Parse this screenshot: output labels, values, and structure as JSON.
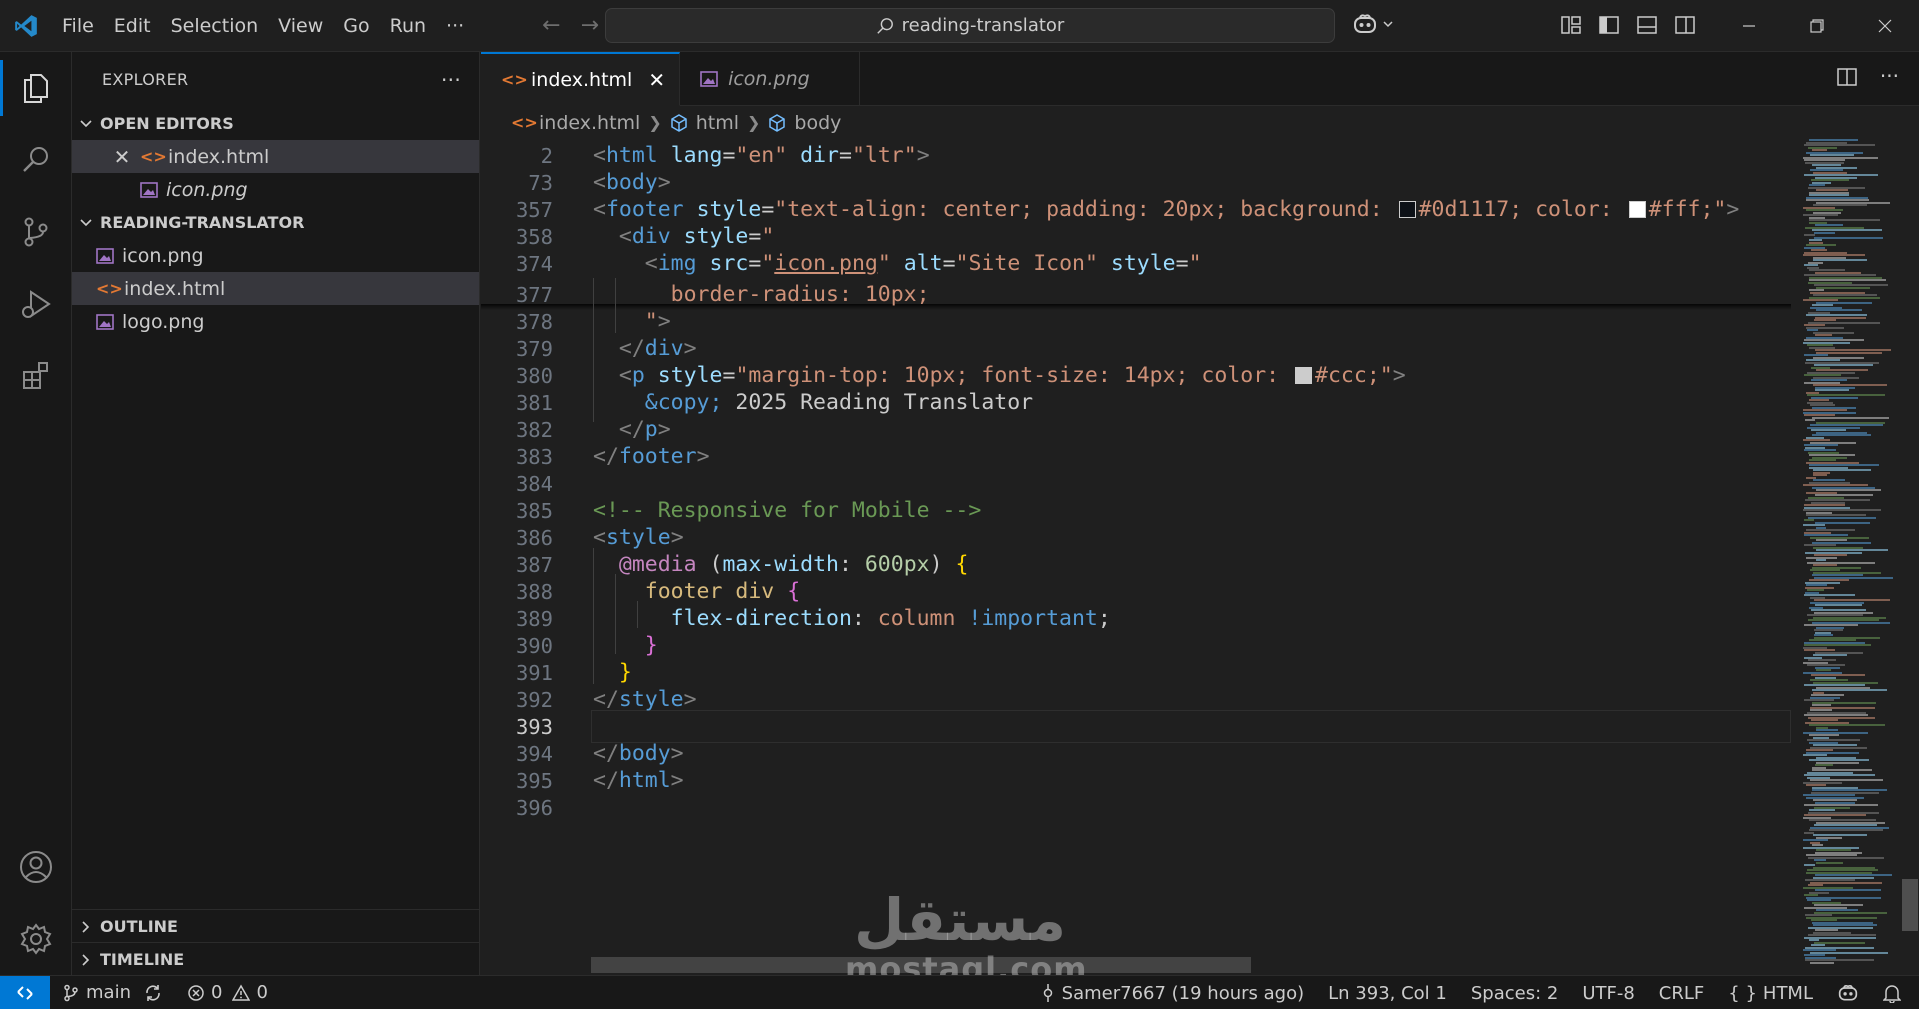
{
  "menu": [
    "File",
    "Edit",
    "Selection",
    "View",
    "Go",
    "Run",
    "···"
  ],
  "command_center": "reading-translator",
  "sidebar": {
    "title": "EXPLORER",
    "more": "···",
    "open_editors_label": "OPEN EDITORS",
    "open_editors": [
      {
        "name": "index.html",
        "type": "html",
        "italic": false
      },
      {
        "name": "icon.png",
        "type": "image",
        "italic": true
      }
    ],
    "project_label": "READING-TRANSLATOR",
    "files": [
      {
        "name": "icon.png",
        "type": "image"
      },
      {
        "name": "index.html",
        "type": "html"
      },
      {
        "name": "logo.png",
        "type": "image"
      }
    ],
    "outline_label": "OUTLINE",
    "timeline_label": "TIMELINE"
  },
  "tabs": [
    {
      "label": "index.html",
      "active": true
    },
    {
      "label": "icon.png",
      "active": false
    }
  ],
  "breadcrumb": [
    "index.html",
    "html",
    "body"
  ],
  "editor": {
    "lines": [
      {
        "n": "2",
        "html": "<span class='t-br'>&lt;</span><span class='t-tag'>html</span> <span class='t-attr'>lang</span><span class='t-txt'>=</span><span class='t-str'>\"en\"</span> <span class='t-attr'>dir</span><span class='t-txt'>=</span><span class='t-str'>\"ltr\"</span><span class='t-br'>&gt;</span>"
      },
      {
        "n": "73",
        "html": "<span class='t-br'>&lt;</span><span class='t-tag'>body</span><span class='t-br'>&gt;</span>"
      },
      {
        "n": "357",
        "html": "<span class='t-br'>&lt;</span><span class='t-tag'>footer</span> <span class='t-attr'>style</span><span class='t-txt'>=</span><span class='t-str'>\"text-align: center; padding: 20px; background: <span class='swatch' style='background:#0d1117'></span>#0d1117; color: <span class='swatch' style='background:#ffffff'></span>#fff;\"</span><span class='t-br'>&gt;</span>"
      },
      {
        "n": "358",
        "html": "  <span class='t-br'>&lt;</span><span class='t-tag'>div</span> <span class='t-attr'>style</span><span class='t-txt'>=</span><span class='t-str'>\"</span>"
      },
      {
        "n": "374",
        "html": "    <span class='t-br'>&lt;</span><span class='t-tag'>img</span> <span class='t-attr'>src</span><span class='t-txt'>=</span><span class='t-str'>\"<u>icon.png</u>\"</span> <span class='t-attr'>alt</span><span class='t-txt'>=</span><span class='t-str'>\"Site Icon\"</span> <span class='t-attr'>style</span><span class='t-txt'>=</span><span class='t-str'>\"</span>"
      },
      {
        "n": "377",
        "html": "      <span class='t-str'>border-radius: 10px;</span>"
      },
      {
        "n": "378",
        "html": "    <span class='t-str'>\"</span><span class='t-br'>&gt;</span>"
      },
      {
        "n": "379",
        "html": "  <span class='t-br'>&lt;/</span><span class='t-tag'>div</span><span class='t-br'>&gt;</span>"
      },
      {
        "n": "380",
        "html": "  <span class='t-br'>&lt;</span><span class='t-tag'>p</span> <span class='t-attr'>style</span><span class='t-txt'>=</span><span class='t-str'>\"margin-top: 10px; font-size: 14px; color: <span class='swatch' style='background:#cccccc'></span>#ccc;\"</span><span class='t-br'>&gt;</span>"
      },
      {
        "n": "381",
        "html": "    <span class='t-ent'>&amp;copy;</span><span class='t-txt'> 2025 Reading Translator</span>"
      },
      {
        "n": "382",
        "html": "  <span class='t-br'>&lt;/</span><span class='t-tag'>p</span><span class='t-br'>&gt;</span>"
      },
      {
        "n": "383",
        "html": "<span class='t-br'>&lt;/</span><span class='t-tag'>footer</span><span class='t-br'>&gt;</span>"
      },
      {
        "n": "384",
        "html": ""
      },
      {
        "n": "385",
        "html": "<span class='t-com'>&lt;!-- Responsive for Mobile --&gt;</span>"
      },
      {
        "n": "386",
        "html": "<span class='t-br'>&lt;</span><span class='t-tag'>style</span><span class='t-br'>&gt;</span>"
      },
      {
        "n": "387",
        "html": "  <span class='t-at'>@media</span> <span class='t-txt'>(</span><span class='t-attr'>max-width</span><span class='t-txt'>: </span><span class='t-num'>600px</span><span class='t-txt'>)</span> <span class='t-b1'>{</span>"
      },
      {
        "n": "388",
        "html": "    <span class='t-sel'>footer div</span> <span class='t-b2'>{</span>"
      },
      {
        "n": "389",
        "html": "      <span class='t-attr'>flex-direction</span><span class='t-txt'>: </span><span class='t-val'>column</span> <span class='t-kw'>!important</span><span class='t-txt'>;</span>"
      },
      {
        "n": "390",
        "html": "    <span class='t-b2'>}</span>"
      },
      {
        "n": "391",
        "html": "  <span class='t-b1'>}</span>"
      },
      {
        "n": "392",
        "html": "<span class='t-br'>&lt;/</span><span class='t-tag'>style</span><span class='t-br'>&gt;</span>"
      },
      {
        "n": "393",
        "html": "",
        "current": true
      },
      {
        "n": "394",
        "html": "<span class='t-br'>&lt;/</span><span class='t-tag'>body</span><span class='t-br'>&gt;</span>"
      },
      {
        "n": "395",
        "html": "<span class='t-br'>&lt;/</span><span class='t-tag'>html</span><span class='t-br'>&gt;</span>"
      },
      {
        "n": "396",
        "html": ""
      }
    ]
  },
  "status": {
    "branch": "main",
    "errors": "0",
    "warnings": "0",
    "blame": "Samer7667 (19 hours ago)",
    "position": "Ln 393, Col 1",
    "spaces": "Spaces: 2",
    "encoding": "UTF-8",
    "eol": "CRLF",
    "language": "HTML"
  },
  "watermark": {
    "ar": "مستقل",
    "en": "mostaql.com"
  },
  "colors": {
    "accent": "#0078d4",
    "background": "#1f1f1f",
    "sidebar": "#181818"
  }
}
